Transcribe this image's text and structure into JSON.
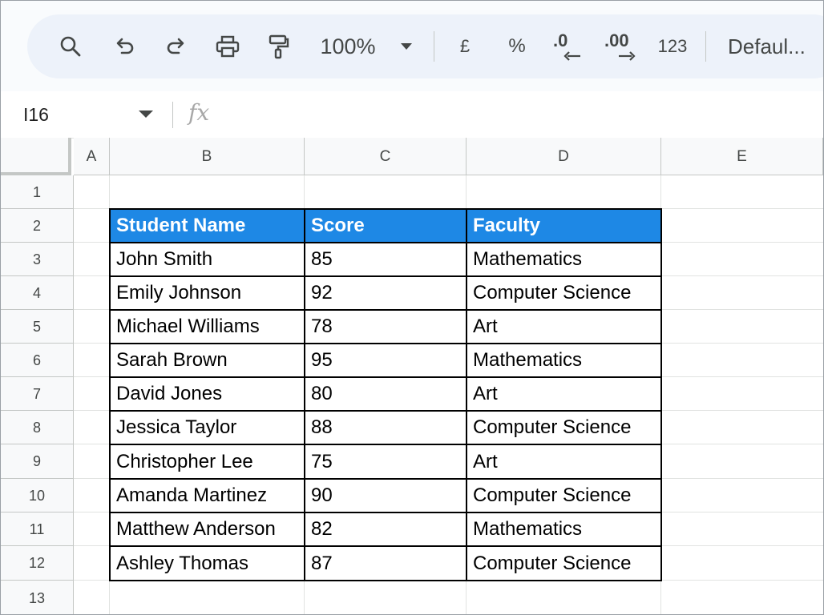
{
  "toolbar": {
    "zoom": "100%",
    "currency": "£",
    "percent": "%",
    "decrease_decimal": ".0",
    "increase_decimal": ".00",
    "number_format": "123",
    "font": "Defaul..."
  },
  "formula_bar": {
    "cell_ref": "I16",
    "fx": "fx"
  },
  "columns": [
    "A",
    "B",
    "C",
    "D",
    "E"
  ],
  "rows": [
    "1",
    "2",
    "3",
    "4",
    "5",
    "6",
    "7",
    "8",
    "9",
    "10",
    "11",
    "12",
    "13"
  ],
  "table": {
    "headers": [
      "Student Name",
      "Score",
      "Faculty"
    ],
    "rows": [
      [
        "John Smith",
        "85",
        "Mathematics"
      ],
      [
        "Emily Johnson",
        "92",
        "Computer Science"
      ],
      [
        "Michael Williams",
        "78",
        "Art"
      ],
      [
        "Sarah Brown",
        "95",
        "Mathematics"
      ],
      [
        "David Jones",
        "80",
        "Art"
      ],
      [
        "Jessica Taylor",
        "88",
        "Computer Science"
      ],
      [
        "Christopher Lee",
        "75",
        "Art"
      ],
      [
        "Amanda Martinez",
        "90",
        "Computer Science"
      ],
      [
        "Matthew Anderson",
        "82",
        "Mathematics"
      ],
      [
        "Ashley Thomas",
        "87",
        "Computer Science"
      ]
    ]
  },
  "colors": {
    "header_fill": "#1e88e5",
    "header_text": "#ffffff",
    "toolbar_bg": "#edf2fa"
  }
}
